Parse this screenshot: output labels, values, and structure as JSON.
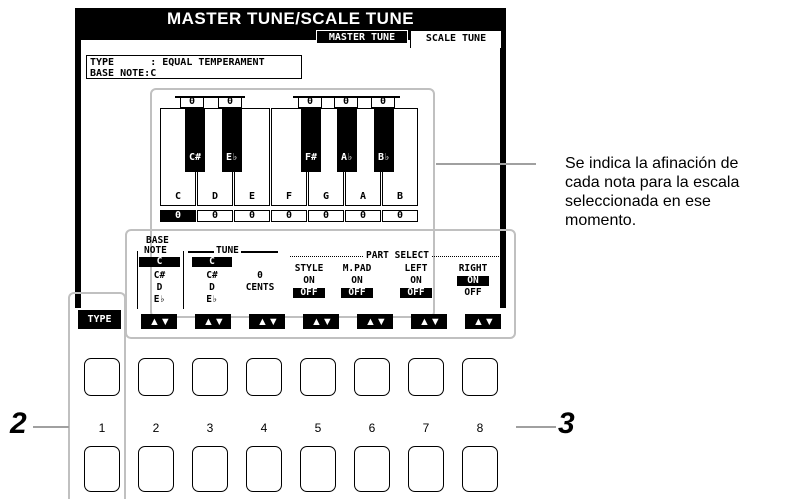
{
  "header": {
    "title": "MASTER TUNE/SCALE TUNE"
  },
  "tabs": [
    {
      "label": "MASTER TUNE",
      "active": false
    },
    {
      "label": "SCALE TUNE",
      "active": true
    }
  ],
  "info": {
    "type_line": "TYPE      : EQUAL TEMPERAMENT",
    "base_note_line": "BASE NOTE:C"
  },
  "black_key_values": [
    "0",
    "0",
    "0",
    "0",
    "0"
  ],
  "black_keys": [
    "C#",
    "E♭",
    "F#",
    "A♭",
    "B♭"
  ],
  "white_keys": [
    "C",
    "D",
    "E",
    "F",
    "G",
    "A",
    "B"
  ],
  "white_key_values": [
    "0",
    "0",
    "0",
    "0",
    "0",
    "0",
    "0"
  ],
  "type_button": "TYPE",
  "base_note": {
    "label_1": "BASE",
    "label_2": "NOTE",
    "options": [
      "C",
      "C#",
      "D",
      "E♭"
    ],
    "selected": "C"
  },
  "tune": {
    "label": "TUNE",
    "options": [
      "C",
      "C#",
      "D",
      "E♭"
    ],
    "selected": "C",
    "value": "0",
    "unit": "CENTS"
  },
  "part_select": {
    "label": "PART SELECT",
    "parts": [
      {
        "name": "STYLE",
        "on": "ON",
        "off": "OFF",
        "selected": "OFF"
      },
      {
        "name": "M.PAD",
        "on": "ON",
        "off": "OFF",
        "selected": "OFF"
      },
      {
        "name": "LEFT",
        "on": "ON",
        "off": "OFF",
        "selected": "OFF"
      },
      {
        "name": "RIGHT",
        "on": "ON",
        "off": "OFF",
        "selected": "ON"
      }
    ]
  },
  "button_numbers": [
    "1",
    "2",
    "3",
    "4",
    "5",
    "6",
    "7",
    "8"
  ],
  "callout_text": [
    "Se indica la afinación de",
    "cada nota para la escala",
    "seleccionada en ese",
    "momento."
  ],
  "step_labels": {
    "left": "2",
    "right": "3"
  }
}
